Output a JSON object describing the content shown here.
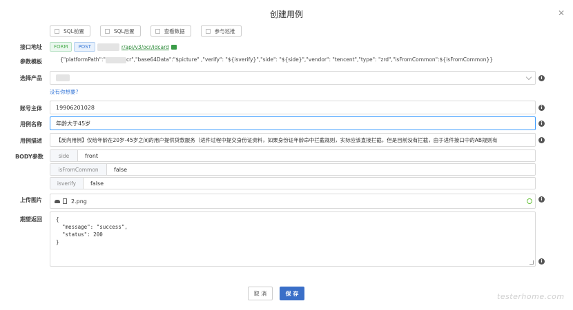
{
  "dialog": {
    "title": "创建用例"
  },
  "options": [
    "SQL前置",
    "SQL后置",
    "查看数据",
    "参与巡推"
  ],
  "labels": {
    "interface": "接口地址",
    "template": "参数模板",
    "product": "选择产品",
    "account": "账号主体",
    "case_name": "用例名称",
    "case_desc": "用例描述",
    "body": "BODY参数",
    "upload": "上传图片",
    "expected": "期望返回"
  },
  "interface": {
    "tags": [
      "FORM",
      "POST"
    ],
    "url_suffix": "r/api/v3/ocr/idcard"
  },
  "template": {
    "prefix": "{\"platformPath\":\"",
    "suffix": "cr\",\"base64Data\":\"$picture\" ,\"verify\": \"${isverify}\",\"side\": \"${side}\",\"vendor\": \"tencent\",\"type\": \"zrd\",\"isFromCommon\":${isFromCommon}}"
  },
  "product": {
    "link": "没有你想要?"
  },
  "account": {
    "value": "19906201028"
  },
  "case_name": {
    "value": "年龄大于45岁"
  },
  "case_desc": {
    "value": "【反向用例】仅给年龄在20岁-45岁之间的用户提供贷款服务（进件过程中提交身份证资料，如果身份证年龄命中拦截规则，实际应该直接拦截，但是目前没有拦截，由于进件接口中的AB规则有"
  },
  "body_params": [
    {
      "key": "side",
      "value": "front"
    },
    {
      "key": "isFromCommon",
      "value": "false"
    },
    {
      "key": "isverify",
      "value": "false"
    }
  ],
  "upload": {
    "filename": "2.png"
  },
  "expected": {
    "value": "{\n  \"message\": \"success\",\n  \"status\": 200\n}"
  },
  "buttons": {
    "cancel": "取 消",
    "save": "保 存"
  },
  "watermark": "testerhome.com",
  "colors": {
    "primary": "#3a6fc8",
    "form_tag": "#4caf50",
    "post_tag": "#3a7ad8",
    "focus": "#409eff"
  }
}
